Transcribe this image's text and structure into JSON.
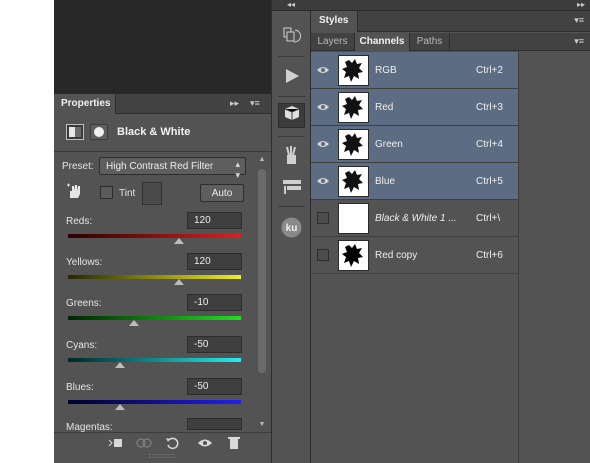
{
  "properties": {
    "tab_label": "Properties",
    "panel_controls": "▸▸",
    "menu_icon": "▾≡",
    "adjustment_title": "Black & White",
    "preset_label": "Preset:",
    "preset_value": "High Contrast Red Filter",
    "tint_label": "Tint",
    "auto_label": "Auto",
    "sliders": [
      {
        "label": "Reds:",
        "value": "120",
        "level": 120,
        "gradient": [
          "#2a0000",
          "#e02020"
        ]
      },
      {
        "label": "Yellows:",
        "value": "120",
        "level": 120,
        "gradient": [
          "#262600",
          "#f0f020"
        ]
      },
      {
        "label": "Greens:",
        "value": "-10",
        "level": -10,
        "gradient": [
          "#002400",
          "#20e020"
        ]
      },
      {
        "label": "Cyans:",
        "value": "-50",
        "level": -50,
        "gradient": [
          "#002626",
          "#20f0f0"
        ]
      },
      {
        "label": "Blues:",
        "value": "-50",
        "level": -50,
        "gradient": [
          "#00002a",
          "#2020f0"
        ]
      },
      {
        "label": "Magentas:",
        "value": ""
      }
    ],
    "slider_range": [
      -200,
      300
    ]
  },
  "toolstrip": {
    "collapse_icon": "◂◂",
    "tools": [
      "history-icon",
      "play-actions-icon",
      "adjustments-icon",
      "brush-presets-icon",
      "tool-presets-icon",
      "kuler-icon"
    ],
    "kuler_label": "ku"
  },
  "right_panel": {
    "collapse_icon": "▸▸",
    "styles_tab": "Styles",
    "tabs": [
      "Layers",
      "Channels",
      "Paths"
    ],
    "active_tab": "Channels",
    "channels": [
      {
        "name": "RGB",
        "shortcut": "Ctrl+2",
        "visible": true,
        "selected": true,
        "thumb": "splat"
      },
      {
        "name": "Red",
        "shortcut": "Ctrl+3",
        "visible": true,
        "selected": true,
        "thumb": "splat"
      },
      {
        "name": "Green",
        "shortcut": "Ctrl+4",
        "visible": true,
        "selected": true,
        "thumb": "splat"
      },
      {
        "name": "Blue",
        "shortcut": "Ctrl+5",
        "visible": true,
        "selected": true,
        "thumb": "splat"
      },
      {
        "name": "Black & White 1 ...",
        "shortcut": "Ctrl+\\",
        "visible": false,
        "selected": false,
        "thumb": "white",
        "italic": true
      },
      {
        "name": "Red copy",
        "shortcut": "Ctrl+6",
        "visible": false,
        "selected": false,
        "thumb": "solid"
      }
    ],
    "selection_color": "#5c6c83"
  }
}
